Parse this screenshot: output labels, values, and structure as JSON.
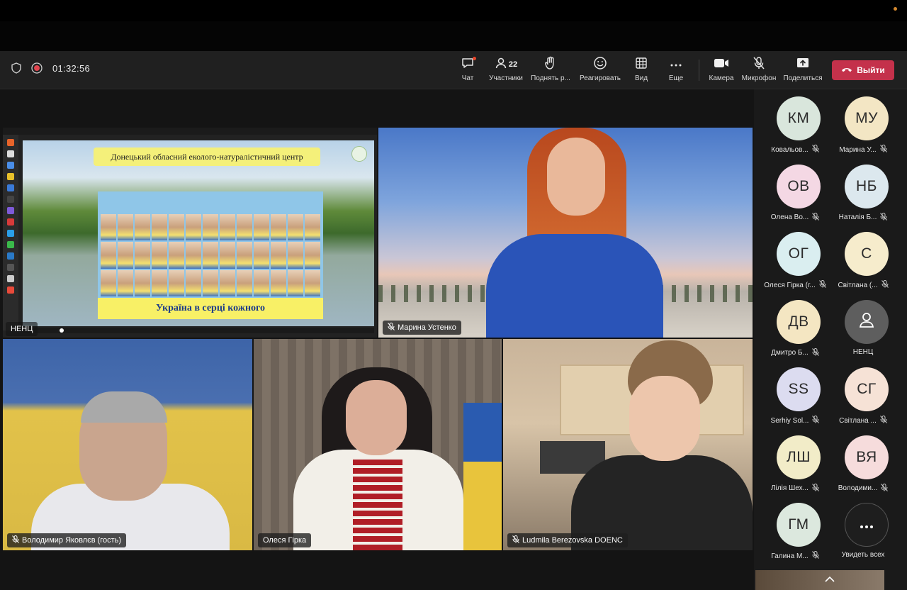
{
  "call": {
    "timer": "01:32:56"
  },
  "toolbar": {
    "chat": {
      "label": "Чат",
      "icon": "chat-icon"
    },
    "participants": {
      "label": "Участники",
      "count": "22",
      "icon": "people-icon"
    },
    "raise_hand": {
      "label": "Поднять р...",
      "icon": "hand-icon"
    },
    "react": {
      "label": "Реагировать",
      "icon": "smile-icon"
    },
    "view": {
      "label": "Вид",
      "icon": "grid-icon"
    },
    "more": {
      "label": "Еще",
      "icon": "ellipsis-icon"
    },
    "camera": {
      "label": "Камера",
      "icon": "camera-icon"
    },
    "mic": {
      "label": "Микрофон",
      "icon": "mic-off-icon"
    },
    "share": {
      "label": "Поделиться",
      "icon": "share-icon"
    },
    "leave": {
      "label": "Выйти",
      "icon": "phone-hangup-icon",
      "color": "#c4314b"
    }
  },
  "stage": {
    "share_tile": {
      "name": "НЕНЦ",
      "banner": "Донецький обласний еколого-натуралістичний центр",
      "slogan": "Україна в серці кожного"
    },
    "tiles": [
      {
        "name": "Марина Устенко"
      },
      {
        "name": "Володимир Яковлєв (гость)"
      },
      {
        "name": "Олеся Гірка"
      },
      {
        "name": "Ludmila Berezovska DOENC"
      }
    ]
  },
  "participants": [
    {
      "initials": "КМ",
      "name": "Ковальов...",
      "color": "#d9e6dc"
    },
    {
      "initials": "МУ",
      "name": "Марина У...",
      "color": "#f3e6c4"
    },
    {
      "initials": "ОВ",
      "name": "Олена Во...",
      "color": "#f4d8e4"
    },
    {
      "initials": "НБ",
      "name": "Наталія Б...",
      "color": "#dce8ee"
    },
    {
      "initials": "ОГ",
      "name": "Олеся Гірка (г...",
      "color": "#daeef0"
    },
    {
      "initials": "С",
      "name": "Світлана (...",
      "color": "#f6eccc"
    },
    {
      "initials": "ДВ",
      "name": "Дмитро Б...",
      "color": "#f4e6c2"
    },
    {
      "initials": "",
      "name": "НЕНЦ",
      "color": "#5e5e5e"
    },
    {
      "initials": "SS",
      "name": "Serhiy Sol...",
      "color": "#dcdcf0"
    },
    {
      "initials": "СГ",
      "name": "Світлана ...",
      "color": "#f6e2d6"
    },
    {
      "initials": "ЛШ",
      "name": "Лілія Шех...",
      "color": "#f2ecc8"
    },
    {
      "initials": "ВЯ",
      "name": "Володими...",
      "color": "#f6dcdc"
    },
    {
      "initials": "ГМ",
      "name": "Галина М...",
      "color": "#dce8de"
    },
    {
      "initials": "",
      "name": "Увидеть всех",
      "color": "#1e1e1e"
    }
  ]
}
